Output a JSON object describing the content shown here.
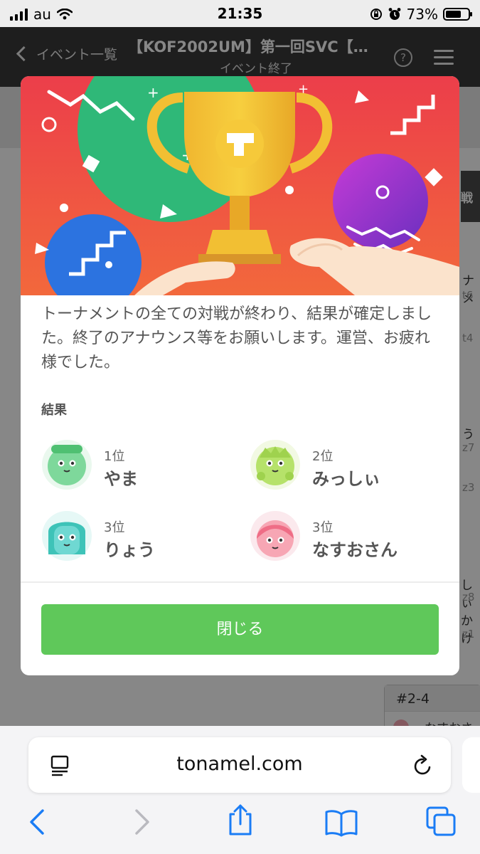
{
  "status_bar": {
    "carrier": "au",
    "time": "21:35",
    "battery": "73%",
    "battery_level": 0.73
  },
  "header": {
    "back_label": "イベント一覧",
    "title": "【KOF2002UM】第一回SVC【…",
    "subtitle": "イベント終了",
    "help_glyph": "?"
  },
  "background": {
    "side_tab": "戦",
    "fragments": [
      "ナメ",
      "t6",
      "t4",
      "う",
      "z7",
      "z3",
      "しぃ",
      "z8",
      "かけ",
      "z1"
    ],
    "match_id": "#2-4",
    "match_player": "なすおさ"
  },
  "modal": {
    "message": "トーナメントの全ての対戦が終わり、結果が確定しました。終了のアナウンス等をお願いします。運営、お疲れ様でした。",
    "results_label": "結果",
    "results": [
      {
        "rank": "1位",
        "name": "やま",
        "color": "#7ed89b"
      },
      {
        "rank": "2位",
        "name": "みっしぃ",
        "color": "#b6e26a"
      },
      {
        "rank": "3位",
        "name": "りょう",
        "color": "#6fd8d2"
      },
      {
        "rank": "3位",
        "name": "なすおさん",
        "color": "#f7a6b4"
      }
    ],
    "close_label": "閉じる",
    "accent_color": "#5fc85a"
  },
  "browser": {
    "url": "tonamel.com"
  }
}
